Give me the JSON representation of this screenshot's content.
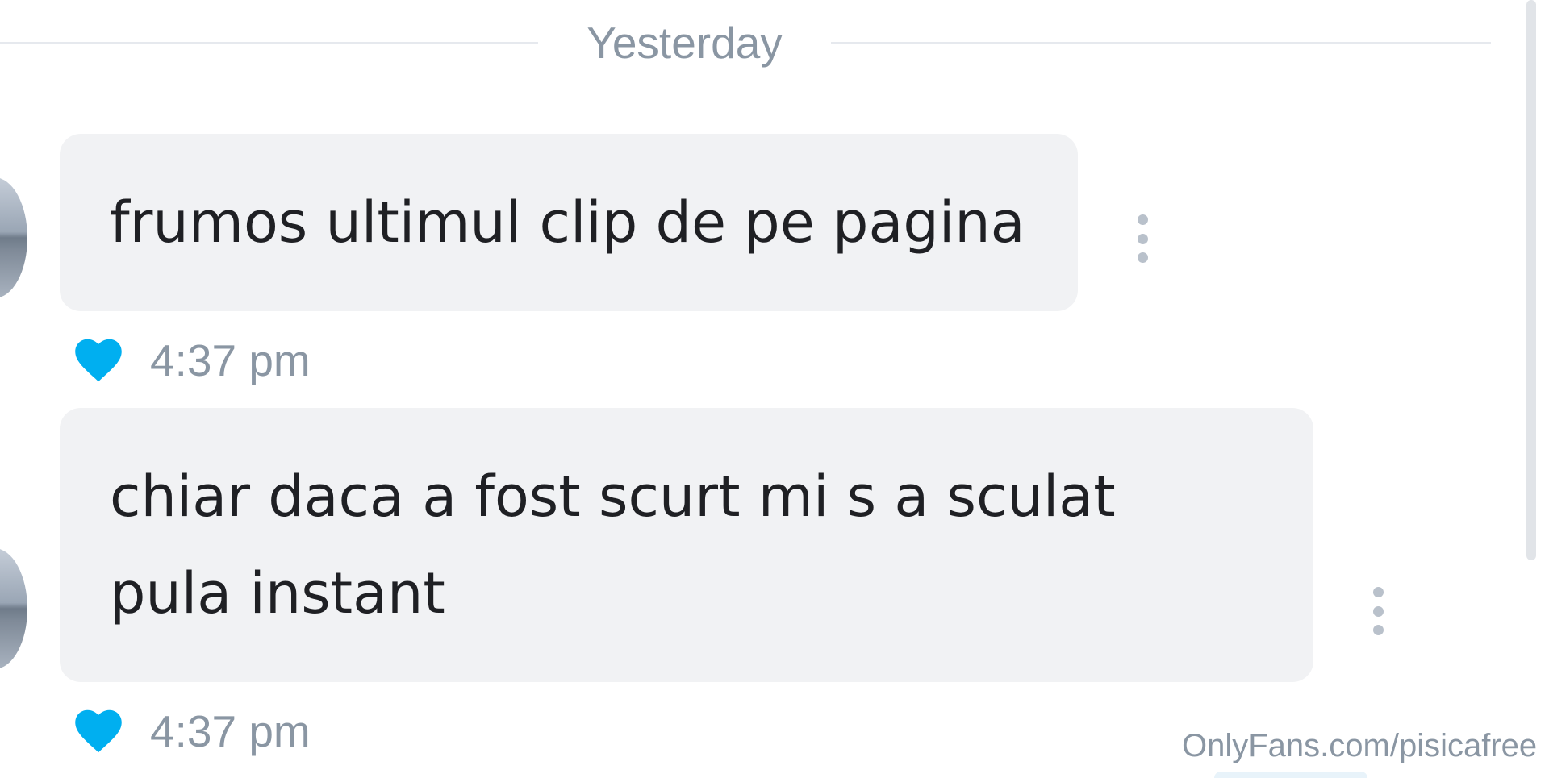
{
  "date_separator": "Yesterday",
  "messages": [
    {
      "text": "frumos ultimul clip de pe pagina",
      "time": "4:37 pm",
      "liked": true
    },
    {
      "text": "chiar daca a fost scurt mi s a sculat pula instant",
      "time": "4:37 pm",
      "liked": true
    }
  ],
  "watermark": "OnlyFans.com/pisicafree",
  "colors": {
    "bubble_bg": "#f1f2f4",
    "heart": "#00aff0",
    "muted_text": "#8a96a3",
    "message_text": "#1f2024"
  },
  "icons": {
    "like": "heart-icon",
    "more": "more-options-icon"
  }
}
